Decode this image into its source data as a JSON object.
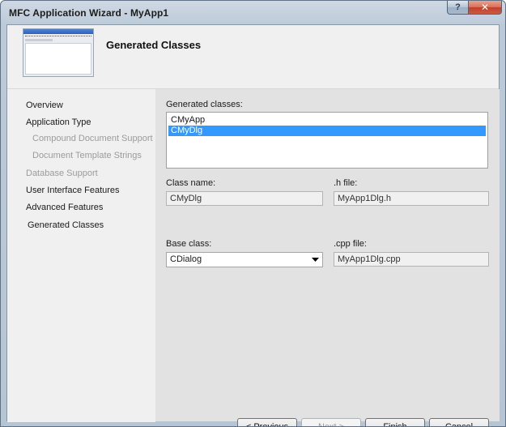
{
  "window": {
    "title": "MFC Application Wizard - MyApp1",
    "help_glyph": "?",
    "close_glyph": "✕"
  },
  "banner": {
    "title": "Generated Classes"
  },
  "nav": {
    "items": [
      {
        "label": "Overview",
        "enabled": true
      },
      {
        "label": "Application Type",
        "enabled": true
      },
      {
        "label": "Compound Document Support",
        "enabled": false
      },
      {
        "label": "Document Template Strings",
        "enabled": false
      },
      {
        "label": "Database Support",
        "enabled": false
      },
      {
        "label": "User Interface Features",
        "enabled": true
      },
      {
        "label": "Advanced Features",
        "enabled": true
      },
      {
        "label": "Generated Classes",
        "enabled": true
      }
    ]
  },
  "form": {
    "generated_classes_label": "Generated classes:",
    "generated_classes": [
      "CMyApp",
      "CMyDlg"
    ],
    "selected_class": "CMyDlg",
    "class_name_label": "Class name:",
    "class_name_value": "CMyDlg",
    "h_file_label": ".h file:",
    "h_file_value": "MyApp1Dlg.h",
    "base_class_label": "Base class:",
    "base_class_value": "CDialog",
    "cpp_file_label": ".cpp file:",
    "cpp_file_value": "MyApp1Dlg.cpp"
  },
  "buttons": {
    "previous": "< Previous",
    "next": "Next >",
    "finish": "Finish",
    "cancel": "Cancel"
  },
  "colors": {
    "selection": "#3399ff",
    "panel": "#e2e2e2",
    "disabled_text": "#9b9b9b"
  }
}
